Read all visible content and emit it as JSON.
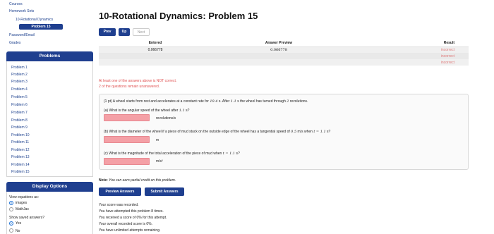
{
  "sidebar": {
    "nav": [
      "Courses",
      "Homework Sets",
      "10-Rotational Dynamics",
      "Problem 15",
      "Password/Email",
      "Grades"
    ],
    "problems_header": "Problems",
    "problems": [
      "Problem 1",
      "Problem 2",
      "Problem 3",
      "Problem 4",
      "Problem 5",
      "Problem 6",
      "Problem 7",
      "Problem 8",
      "Problem 9",
      "Problem 10",
      "Problem 11",
      "Problem 12",
      "Problem 13",
      "Problem 14",
      "Problem 15"
    ],
    "display_header": "Display Options",
    "view_equations_label": "View equations as:",
    "view_options": [
      "images",
      "MathJax"
    ],
    "view_selected": "images",
    "show_saved_label": "Show saved answers?",
    "saved_options": [
      "Yes",
      "No"
    ],
    "saved_selected": "Yes"
  },
  "main": {
    "title": "10-Rotational Dynamics: Problem 15",
    "nav_buttons": {
      "prev": "Prev",
      "up": "Up",
      "next": "Next"
    },
    "results_table": {
      "headers": [
        "Entered",
        "Answer Preview",
        "Result"
      ],
      "rows": [
        {
          "entered": "0.066778",
          "preview": "0.066778",
          "result": "incorrect"
        },
        {
          "entered": "",
          "preview": "",
          "result": "incorrect"
        },
        {
          "entered": "",
          "preview": "",
          "result": "incorrect"
        }
      ]
    },
    "warning_1": "At least one of the answers above is NOT correct.",
    "warning_2": "2 of the questions remain unanswered.",
    "problem": {
      "intro_a": "(1 pt) A wheel starts from rest and accelerates at a constant rate for",
      "intro_time": "19.4",
      "intro_b": "s. After",
      "intro_t": "1.1",
      "intro_c": "s the wheel has turned through",
      "intro_rev": "2",
      "intro_d": "revolutions.",
      "part_a": "(a) What is the angular speed of the wheel after",
      "part_a_t": "1.1",
      "part_a_end": "s?",
      "unit_a": "revolutions/s",
      "part_b": "(b) What is the diameter of the wheel if a piece of mud stuck on the outside edge of the wheel has a tangential speed of",
      "part_b_v": "0.5",
      "part_b_mid": "m/s when",
      "part_b_t": "t = 1.1",
      "part_b_end": "s?",
      "unit_b": "m",
      "part_c": "(c) What is the magnitude of the total acceleration of the piece of mud when",
      "part_c_t": "t = 1.1",
      "part_c_end": "s?",
      "unit_c": "m/s²"
    },
    "note_label": "Note:",
    "note_text": "You can earn partial credit on this problem.",
    "buttons": {
      "preview": "Preview Answers",
      "submit": "Submit Answers"
    },
    "status": [
      "Your score was recorded.",
      "You have attempted this problem 8 times.",
      "You received a score of 0% for this attempt.",
      "Your overall recorded score is 0%.",
      "You have unlimited attempts remaining."
    ]
  },
  "colors": {
    "primary": "#1f3f8f",
    "incorrect": "#e07a7a",
    "warning": "#e05050",
    "answer_field": "#f4a0a6"
  }
}
